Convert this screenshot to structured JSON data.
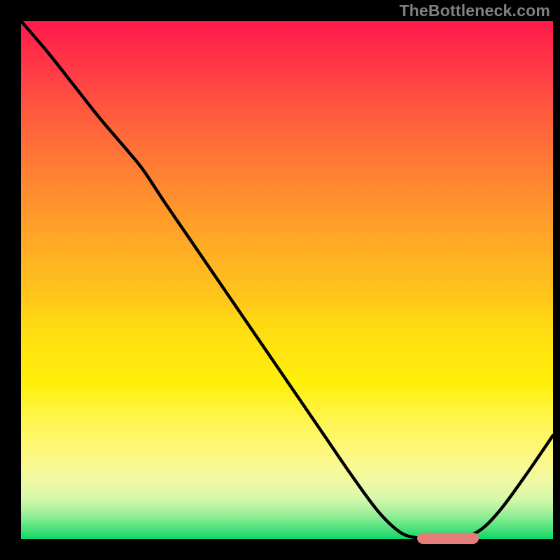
{
  "watermark": "TheBottleneck.com",
  "colors": {
    "background": "#000000",
    "curve": "#000000",
    "marker": "#e67d7a",
    "watermark_text": "#808080"
  },
  "chart_data": {
    "type": "line",
    "title": "",
    "xlabel": "",
    "ylabel": "",
    "xlim": [
      0,
      100
    ],
    "ylim": [
      0,
      100
    ],
    "grid": false,
    "legend": false,
    "note": "Axes have no visible tick labels; x/y are normalized 0-100 from plot-area pixels.",
    "series": [
      {
        "name": "bottleneck-curve",
        "x": [
          0,
          5,
          10,
          15,
          20,
          23,
          27,
          32,
          37,
          42,
          47,
          52,
          57,
          62,
          67,
          71,
          74,
          78,
          82,
          86,
          90,
          95,
          100
        ],
        "y": [
          100,
          94,
          87.5,
          81,
          75,
          71.2,
          65,
          57.5,
          50,
          42.5,
          35,
          27.5,
          20,
          12.5,
          5.5,
          1.5,
          0.3,
          0.2,
          0.2,
          1.5,
          5.5,
          12.5,
          20
        ]
      }
    ],
    "optimal_marker": {
      "x_start": 74.5,
      "x_end": 86,
      "y": 0.2
    },
    "gradient_stops": [
      {
        "pos": 0,
        "color": "#ff1a4a"
      },
      {
        "pos": 50,
        "color": "#ffc81a"
      },
      {
        "pos": 85,
        "color": "#fff774"
      },
      {
        "pos": 100,
        "color": "#0cd969"
      }
    ]
  }
}
